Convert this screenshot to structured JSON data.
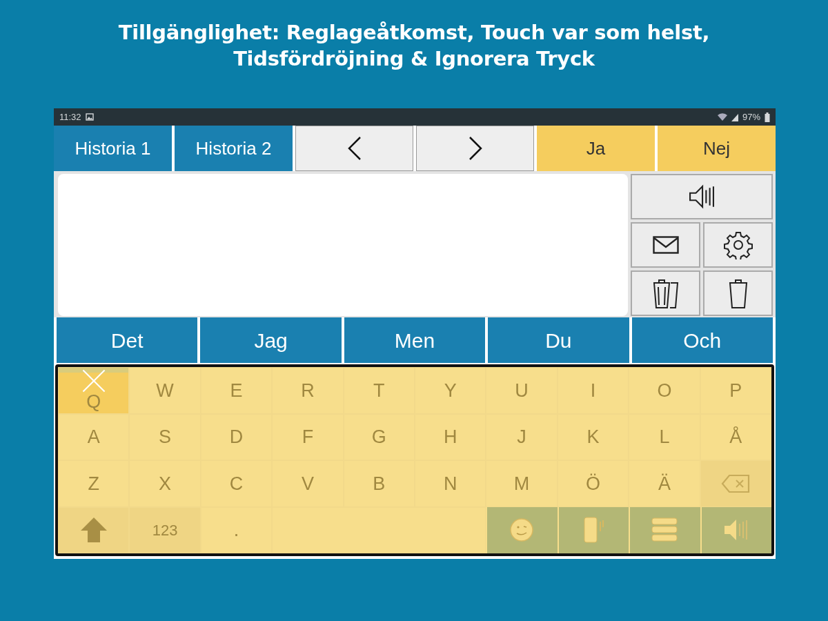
{
  "headline": [
    "Tillgänglighet: Reglageåtkomst, Touch var som helst,",
    "Tidsfördröjning & Ignorera Tryck"
  ],
  "status_bar": {
    "time": "11:32",
    "battery": "97%"
  },
  "top_buttons": [
    {
      "kind": "history",
      "label": "Historia 1"
    },
    {
      "kind": "history",
      "label": "Historia 2"
    },
    {
      "kind": "prev"
    },
    {
      "kind": "next"
    },
    {
      "kind": "answer",
      "label": "Ja"
    },
    {
      "kind": "answer",
      "label": "Nej"
    }
  ],
  "side_buttons": [
    {
      "kind": "speak"
    },
    {
      "kind": "mail"
    },
    {
      "kind": "settings"
    },
    {
      "kind": "clear-all"
    },
    {
      "kind": "delete"
    }
  ],
  "word_predictions": [
    "Det",
    "Jag",
    "Men",
    "Du",
    "Och"
  ],
  "keyboard": {
    "ignore_touch": true,
    "rows": [
      [
        {
          "kind": "letter",
          "label": "Q"
        },
        {
          "kind": "letter",
          "label": "W"
        },
        {
          "kind": "letter",
          "label": "E"
        },
        {
          "kind": "letter",
          "label": "R"
        },
        {
          "kind": "letter",
          "label": "T"
        },
        {
          "kind": "letter",
          "label": "Y"
        },
        {
          "kind": "letter",
          "label": "U"
        },
        {
          "kind": "letter",
          "label": "I"
        },
        {
          "kind": "letter",
          "label": "O"
        },
        {
          "kind": "letter",
          "label": "P"
        }
      ],
      [
        {
          "kind": "letter",
          "label": "A"
        },
        {
          "kind": "letter",
          "label": "S"
        },
        {
          "kind": "letter",
          "label": "D"
        },
        {
          "kind": "letter",
          "label": "F"
        },
        {
          "kind": "letter",
          "label": "G"
        },
        {
          "kind": "letter",
          "label": "H"
        },
        {
          "kind": "letter",
          "label": "J"
        },
        {
          "kind": "letter",
          "label": "K"
        },
        {
          "kind": "letter",
          "label": "L"
        },
        {
          "kind": "letter",
          "label": "Å"
        }
      ],
      [
        {
          "kind": "letter",
          "label": "Z"
        },
        {
          "kind": "letter",
          "label": "X"
        },
        {
          "kind": "letter",
          "label": "C"
        },
        {
          "kind": "letter",
          "label": "V"
        },
        {
          "kind": "letter",
          "label": "B"
        },
        {
          "kind": "letter",
          "label": "N"
        },
        {
          "kind": "letter",
          "label": "M"
        },
        {
          "kind": "letter",
          "label": "Ö"
        },
        {
          "kind": "letter",
          "label": "Ä"
        },
        {
          "kind": "backspace"
        }
      ],
      [
        {
          "kind": "shift"
        },
        {
          "kind": "mode",
          "label": "123"
        },
        {
          "kind": "letter",
          "label": "."
        },
        {
          "kind": "space"
        },
        {
          "kind": "emoji"
        },
        {
          "kind": "vibrate"
        },
        {
          "kind": "menu"
        },
        {
          "kind": "speak"
        }
      ]
    ]
  }
}
